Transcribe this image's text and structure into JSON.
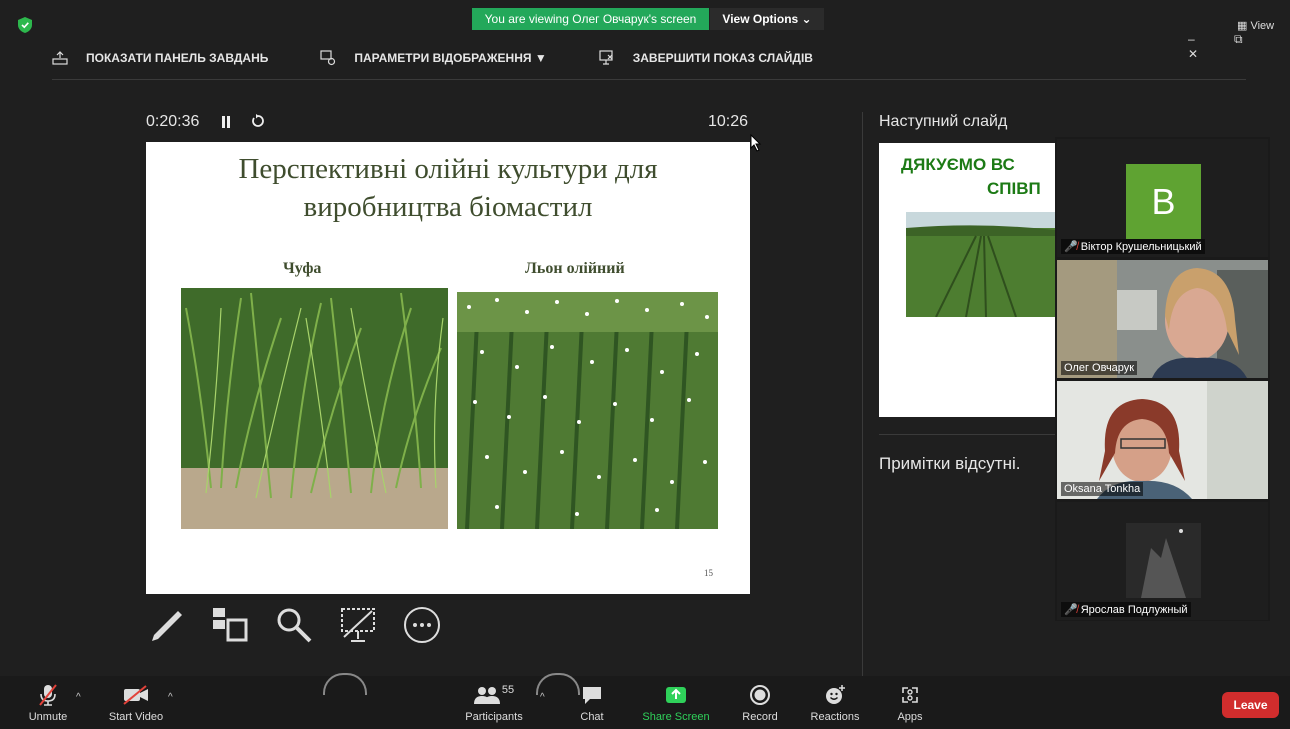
{
  "banner": {
    "viewing": "You are viewing Олег Овчарук's screen",
    "view_options": "View Options ⌄",
    "view": "View",
    "win_controls": "–  ⧉  ✕"
  },
  "toolbar": {
    "show_taskbar": "ПОКАЗАТИ ПАНЕЛЬ ЗАВДАНЬ",
    "display_settings": "ПАРАМЕТРИ ВІДОБРАЖЕННЯ ▼",
    "end_slideshow": "ЗАВЕРШИТИ ПОКАЗ СЛАЙДІВ"
  },
  "presenter": {
    "elapsed": "0:20:36",
    "clock": "10:26"
  },
  "slide": {
    "title_line1": "Перспективні олійні культури для",
    "title_line2": "виробництва біомастил",
    "caption_left": "Чуфа",
    "caption_right": "Льон олійний",
    "number": "15"
  },
  "next": {
    "label": "Наступний слайд",
    "text_line1": "ДЯКУЄМО ВС",
    "text_line2": "СПІВП",
    "notes": "Примітки відсутні."
  },
  "participants_panel": [
    {
      "name": "Віктор Крушельницький",
      "initial": "B",
      "muted": true
    },
    {
      "name": "Олег Овчарук",
      "muted": false,
      "active": true
    },
    {
      "name": "Oksana Tonkha",
      "muted": false
    },
    {
      "name": "Ярослав Подлужный",
      "muted": true
    }
  ],
  "bottombar": {
    "unmute": "Unmute",
    "start_video": "Start Video",
    "participants": "Participants",
    "participants_count": "55",
    "chat": "Chat",
    "share_screen": "Share Screen",
    "record": "Record",
    "reactions": "Reactions",
    "apps": "Apps",
    "leave": "Leave"
  },
  "colors": {
    "banner_green": "#23a85a",
    "leave_red": "#d12d2d",
    "avatar_green": "#5fa332",
    "next_slide_green": "#1c7a15"
  }
}
